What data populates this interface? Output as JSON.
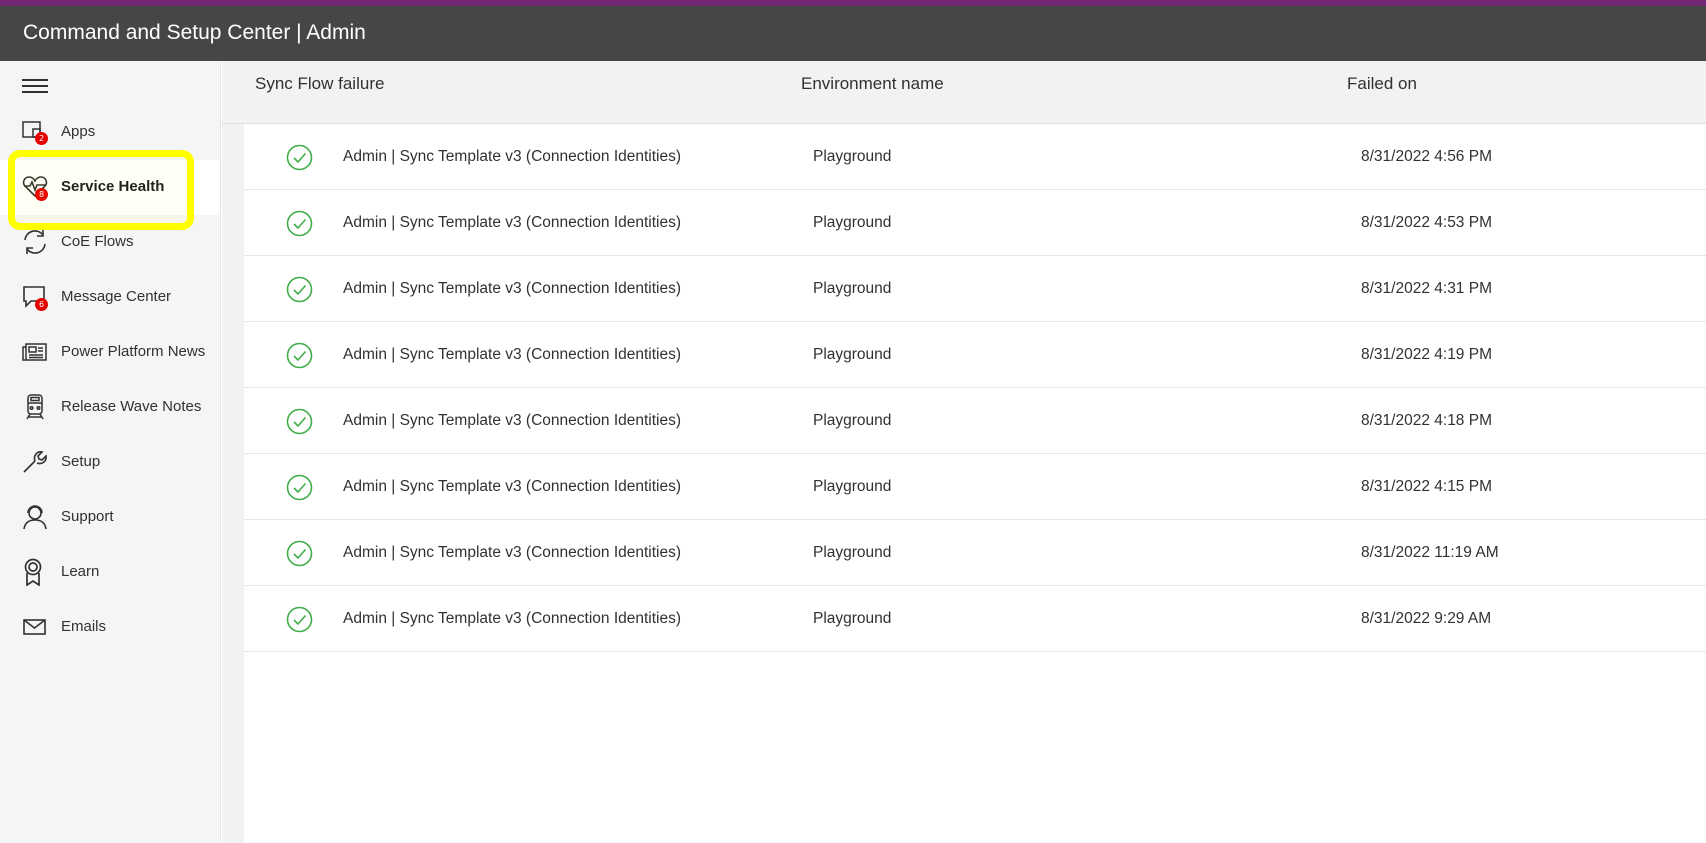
{
  "app": {
    "title": "Command and Setup Center | Admin",
    "accent_color": "#742774",
    "header_color": "#464646"
  },
  "sidebar": {
    "menu_icon": "hamburger-menu-icon",
    "items": [
      {
        "label": "Apps",
        "icon": "apps-icon",
        "badge": "2",
        "active": false
      },
      {
        "label": "Service Health",
        "icon": "heart-pulse-icon",
        "badge": "8",
        "active": true
      },
      {
        "label": "CoE Flows",
        "icon": "sync-icon",
        "badge": "",
        "active": false
      },
      {
        "label": "Message Center",
        "icon": "chat-message-icon",
        "badge": "6",
        "active": false
      },
      {
        "label": "Power Platform News",
        "icon": "news-icon",
        "badge": "",
        "active": false
      },
      {
        "label": "Release Wave Notes",
        "icon": "train-icon",
        "badge": "",
        "active": false
      },
      {
        "label": "Setup",
        "icon": "wrench-icon",
        "badge": "",
        "active": false
      },
      {
        "label": "Support",
        "icon": "headset-person-icon",
        "badge": "",
        "active": false
      },
      {
        "label": "Learn",
        "icon": "ribbon-award-icon",
        "badge": "",
        "active": false
      },
      {
        "label": "Emails",
        "icon": "mail-icon",
        "badge": "",
        "active": false
      }
    ]
  },
  "table": {
    "columns": [
      "Sync Flow failure",
      "Environment name",
      "Failed on"
    ],
    "status_icon": "check-circle-icon",
    "status_color": "#3fae49",
    "rows": [
      {
        "flow": "Admin | Sync Template v3 (Connection Identities)",
        "environment": "Playground",
        "failed_on": "8/31/2022 4:56 PM"
      },
      {
        "flow": "Admin | Sync Template v3 (Connection Identities)",
        "environment": "Playground",
        "failed_on": "8/31/2022 4:53 PM"
      },
      {
        "flow": "Admin | Sync Template v3 (Connection Identities)",
        "environment": "Playground",
        "failed_on": "8/31/2022 4:31 PM"
      },
      {
        "flow": "Admin | Sync Template v3 (Connection Identities)",
        "environment": "Playground",
        "failed_on": "8/31/2022 4:19 PM"
      },
      {
        "flow": "Admin | Sync Template v3 (Connection Identities)",
        "environment": "Playground",
        "failed_on": "8/31/2022 4:18 PM"
      },
      {
        "flow": "Admin | Sync Template v3 (Connection Identities)",
        "environment": "Playground",
        "failed_on": "8/31/2022 4:15 PM"
      },
      {
        "flow": "Admin | Sync Template v3 (Connection Identities)",
        "environment": "Playground",
        "failed_on": "8/31/2022 11:19 AM"
      },
      {
        "flow": "Admin | Sync Template v3 (Connection Identities)",
        "environment": "Playground",
        "failed_on": "8/31/2022 9:29 AM"
      }
    ]
  }
}
